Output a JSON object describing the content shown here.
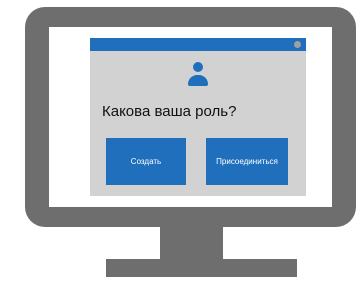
{
  "dialog": {
    "question": "Какова ваша роль?",
    "buttons": {
      "create_label": "Создать",
      "join_label": "Присоединиться"
    },
    "icon": "user-icon"
  },
  "colors": {
    "monitor": "#6e6e6e",
    "screen": "#ffffff",
    "window_bg": "#d2d2d2",
    "accent": "#1f6fbd",
    "titlebar_dot": "#a0a0a0"
  }
}
